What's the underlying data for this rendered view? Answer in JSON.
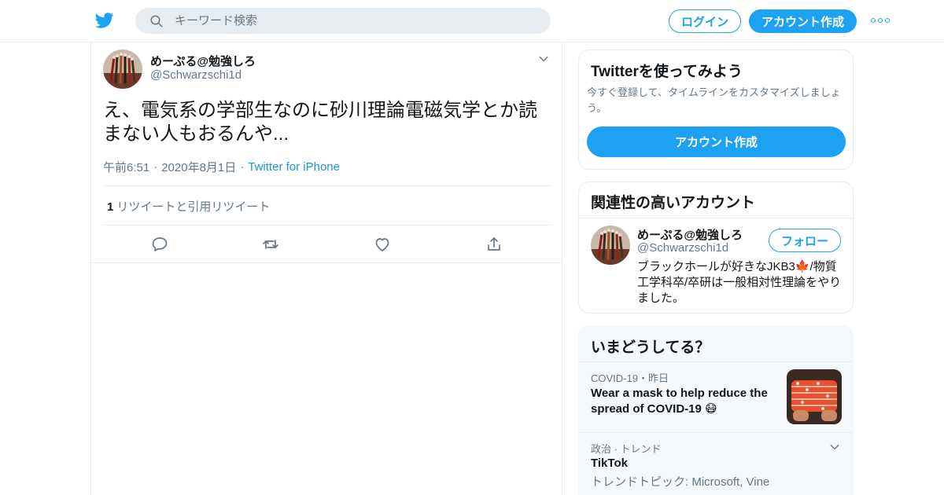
{
  "header": {
    "search_placeholder": "キーワード検索",
    "login_label": "ログイン",
    "signup_label": "アカウント作成",
    "accent_color": "#1da1f2",
    "icons": [
      "twitter-bird-icon",
      "search-icon",
      "more-icon"
    ]
  },
  "tweet": {
    "author_name": "めーぷる@勉強しろ",
    "author_handle": "@Schwarzschi1d",
    "text": "え、電気系の学部生なのに砂川理論電磁気学とか読まない人もおるんや...",
    "time": "午前6:51",
    "date": "2020年8月1日",
    "source": "Twitter for iPhone",
    "retweet_count": "1",
    "retweet_label": "リツイートと引用リツイート",
    "actions": [
      "reply-icon",
      "retweet-icon",
      "like-icon",
      "share-icon"
    ]
  },
  "signup_card": {
    "title": "Twitterを使ってみよう",
    "subtitle": "今すぐ登録して、タイムラインをカスタマイズしましょう。",
    "button_label": "アカウント作成"
  },
  "related_card": {
    "title": "関連性の高いアカウント",
    "name": "めーぷる@勉強しろ",
    "handle": "@Schwarzschi1d",
    "follow_label": "フォロー",
    "bio_line1": "ブラックホールが好きなJKB3🍁/物質",
    "bio_line2": "工学科卒/卒研は一般相対性理論をやり",
    "bio_line3": "ました。"
  },
  "trends_card": {
    "title": "いまどうしてる？",
    "item1_meta": "COVID-19・昨日",
    "item1_line1": "Wear a mask to help reduce the",
    "item1_line2": "spread of COVID-19 😷",
    "item2_meta": "政治 · トレンド",
    "item2_name": "TikTok",
    "item2_sub": "トレンドトピック: Microsoft, Vine",
    "item2_more": "…"
  }
}
